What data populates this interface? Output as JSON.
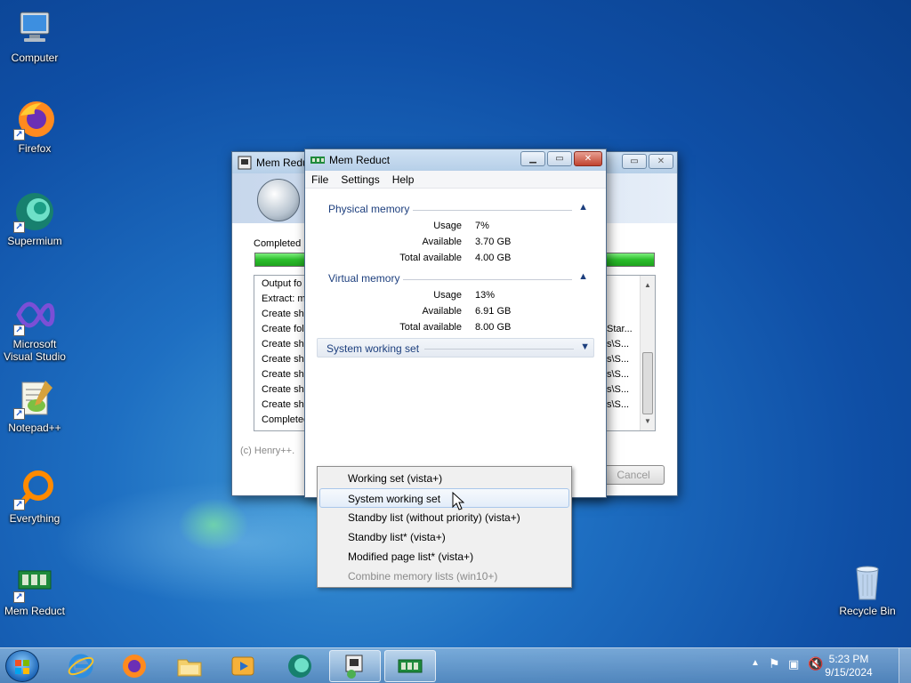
{
  "desktop": {
    "icons": [
      {
        "label": "Computer"
      },
      {
        "label": "Firefox"
      },
      {
        "label": "Supermium"
      },
      {
        "label": "Microsoft Visual Studio"
      },
      {
        "label": "Notepad++"
      },
      {
        "label": "Everything"
      },
      {
        "label": "Mem Reduct"
      },
      {
        "label": "Recycle Bin"
      }
    ]
  },
  "installer": {
    "title": "Mem Reduc",
    "status": "Completed",
    "log_left": [
      "Output fo",
      "Extract: m",
      "Create sh",
      "Create fol",
      "Create sh",
      "Create sh",
      "Create sh",
      "Create sh",
      "Create sh",
      "Completed"
    ],
    "log_right": [
      "",
      "",
      "",
      "Star...",
      "s\\S...",
      "s\\S...",
      "s\\S...",
      "s\\S...",
      "s\\S...",
      ""
    ],
    "copyright": "(c) Henry++.",
    "cancel_label": "Cancel"
  },
  "memreduct": {
    "title": "Mem Reduct",
    "menu": [
      "File",
      "Settings",
      "Help"
    ],
    "physical": {
      "header": "Physical memory",
      "rows": [
        {
          "k": "Usage",
          "v": "7%"
        },
        {
          "k": "Available",
          "v": "3.70 GB"
        },
        {
          "k": "Total available",
          "v": "4.00 GB"
        }
      ]
    },
    "virtual": {
      "header": "Virtual memory",
      "rows": [
        {
          "k": "Usage",
          "v": "13%"
        },
        {
          "k": "Available",
          "v": "6.91 GB"
        },
        {
          "k": "Total available",
          "v": "8.00 GB"
        }
      ]
    },
    "system_ws_header": "System working set"
  },
  "dropdown": {
    "items": [
      {
        "label": "Working set (vista+)",
        "state": "normal"
      },
      {
        "label": "System working set",
        "state": "highlighted"
      },
      {
        "label": "Standby list (without priority) (vista+)",
        "state": "normal"
      },
      {
        "label": "Standby list* (vista+)",
        "state": "normal"
      },
      {
        "label": "Modified page list* (vista+)",
        "state": "normal"
      },
      {
        "label": "Combine memory lists (win10+)",
        "state": "disabled"
      }
    ]
  },
  "taskbar": {
    "time": "5:23 PM",
    "date": "9/15/2024",
    "apps": [
      "internet-explorer",
      "firefox",
      "file-explorer",
      "media-player",
      "supermium",
      "installer",
      "mem-reduct"
    ]
  }
}
